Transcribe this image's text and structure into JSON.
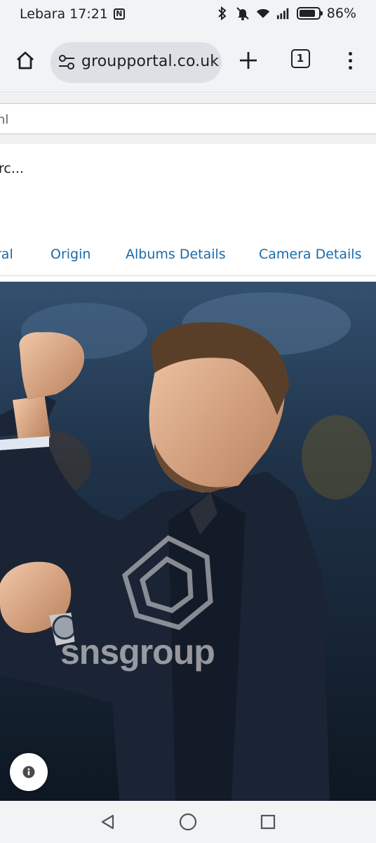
{
  "status_bar": {
    "carrier_time": "Lebara 17:21",
    "nfc_icon_text": "N",
    "battery_percent_text": "86%",
    "battery_level": 0.86
  },
  "toolbar": {
    "url": "groupportal.co.uk",
    "tab_count": "1"
  },
  "page": {
    "search_value": "hl",
    "caption": "rc...",
    "tabs": [
      {
        "label": "ral"
      },
      {
        "label": "Origin"
      },
      {
        "label": "Albums Details"
      },
      {
        "label": "Camera Details"
      }
    ],
    "watermark": "snsgroup"
  },
  "colors": {
    "chrome_bg": "#f1f3f4",
    "omnibox_bg": "#dde1e6",
    "tab_link": "#1a6aa8"
  }
}
